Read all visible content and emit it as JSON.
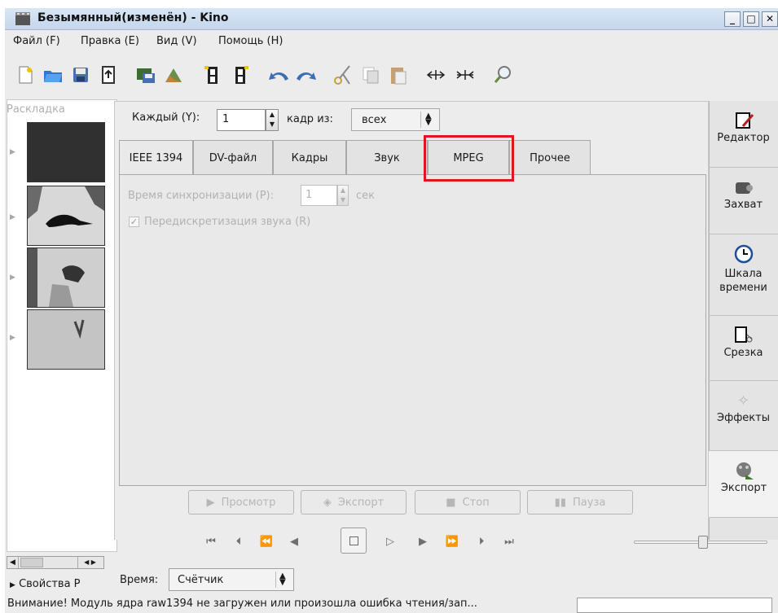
{
  "window": {
    "title": "Безымянный(изменён) - Kino",
    "buttons": {
      "minimize": "_",
      "maximize": "□",
      "close": "✕"
    }
  },
  "menu": [
    "Файл (F)",
    "Правка (E)",
    "Вид (V)",
    "Помощь (H)"
  ],
  "toolbar_icons": [
    "new-file-icon",
    "open-folder-icon",
    "save-icon",
    "export-icon",
    "save-frame-icon",
    "open-image-icon",
    "film-insert-before-icon",
    "film-insert-after-icon",
    "undo-icon",
    "redo-icon",
    "cut-icon",
    "copy-icon",
    "paste-icon",
    "split-icon",
    "join-icon",
    "zoom-icon"
  ],
  "storyboard": {
    "title": "Раскладка"
  },
  "export": {
    "each_label": "Каждый (Y):",
    "each_value": "1",
    "frame_from_label": "кадр из:",
    "frame_from_value": "всех",
    "tabs": [
      "IEEE 1394",
      "DV-файл",
      "Кадры",
      "Звук",
      "MPEG",
      "Прочее"
    ],
    "active_tab": "IEEE 1394",
    "highlighted_tab": "MPEG",
    "sync_label": "Время синхронизации (P):",
    "sync_value": "1",
    "sync_unit": "сек",
    "resample_label": "Передискретизация звука (R)",
    "resample_checked": true,
    "buttons": {
      "preview": "Просмотр",
      "export": "Экспорт",
      "stop": "Стоп",
      "pause": "Пауза"
    }
  },
  "side": {
    "editor": "Редактор",
    "capture": "Захват",
    "timeline": "Шкала времени",
    "trim": "Срезка",
    "effects": "Эффекты",
    "export": "Экспорт",
    "active": "Экспорт"
  },
  "transport": [
    "start-icon",
    "prev-scene-icon",
    "rewind-icon",
    "back-frame-icon",
    "stop-icon",
    "play-icon",
    "forward-frame-icon",
    "fast-forward-icon",
    "next-scene-icon",
    "end-icon"
  ],
  "properties": {
    "label": "Свойства P"
  },
  "time": {
    "label": "Время:",
    "value": "Счётчик"
  },
  "status": {
    "message": "Внимание! Модуль ядра raw1394 не загружен или произошла ошибка чтения/зап..."
  },
  "colors": {
    "highlight": "#e0161c",
    "titlebar": "#c5d6ec",
    "window_bg": "#ececec"
  }
}
